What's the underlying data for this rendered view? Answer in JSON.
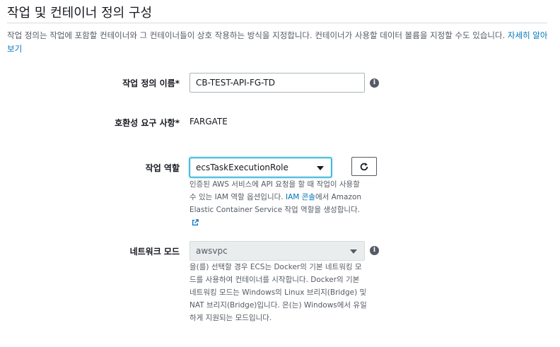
{
  "section": {
    "title": "작업 및 컨테이너 정의 구성",
    "description": "작업 정의는 작업에 포함할 컨테이너와 그 컨테이너들이 상호 작용하는 방식을 지정합니다. 컨테이너가 사용할 데이터 볼륨을 지정할 수도 있습니다. ",
    "learn_more": "자세히 알아보기"
  },
  "task_def_name": {
    "label": "작업 정의 이름*",
    "value": "CB-TEST-API-FG-TD",
    "info_icon": "info-icon"
  },
  "compatibility": {
    "label": "호환성 요구 사항*",
    "value": "FARGATE"
  },
  "task_role": {
    "label": "작업 역할",
    "selected": "ecsTaskExecutionRole",
    "help_part1": "인증된 AWS 서비스에 API 요청을 할 때 작업이 사용할 수 있는 IAM 역할 옵션입니다. ",
    "help_link": "IAM 콘솔",
    "help_part2": "에서 Amazon Elastic Container Service 작업 역할을 생성합니다.",
    "refresh_icon": "refresh-icon",
    "external_icon": "external-link-icon"
  },
  "network_mode": {
    "label": "네트워크 모드",
    "selected": "awsvpc",
    "help": "을(를) 선택할 경우 ECS는 Docker의 기본 네트워킹 모드를 사용하여 컨테이너를 시작합니다. Docker의 기본 네트워킹 모드는 Windows의 Linux 브리지(Bridge) 및 NAT 브리지(Bridge)입니다. 은(는) Windows에서 유일하게 지원되는 모드입니다.",
    "info_icon": "info-icon"
  },
  "colors": {
    "link": "#0073bb",
    "focus": "#00a1c9",
    "text": "#16191f",
    "muted": "#545b64"
  }
}
